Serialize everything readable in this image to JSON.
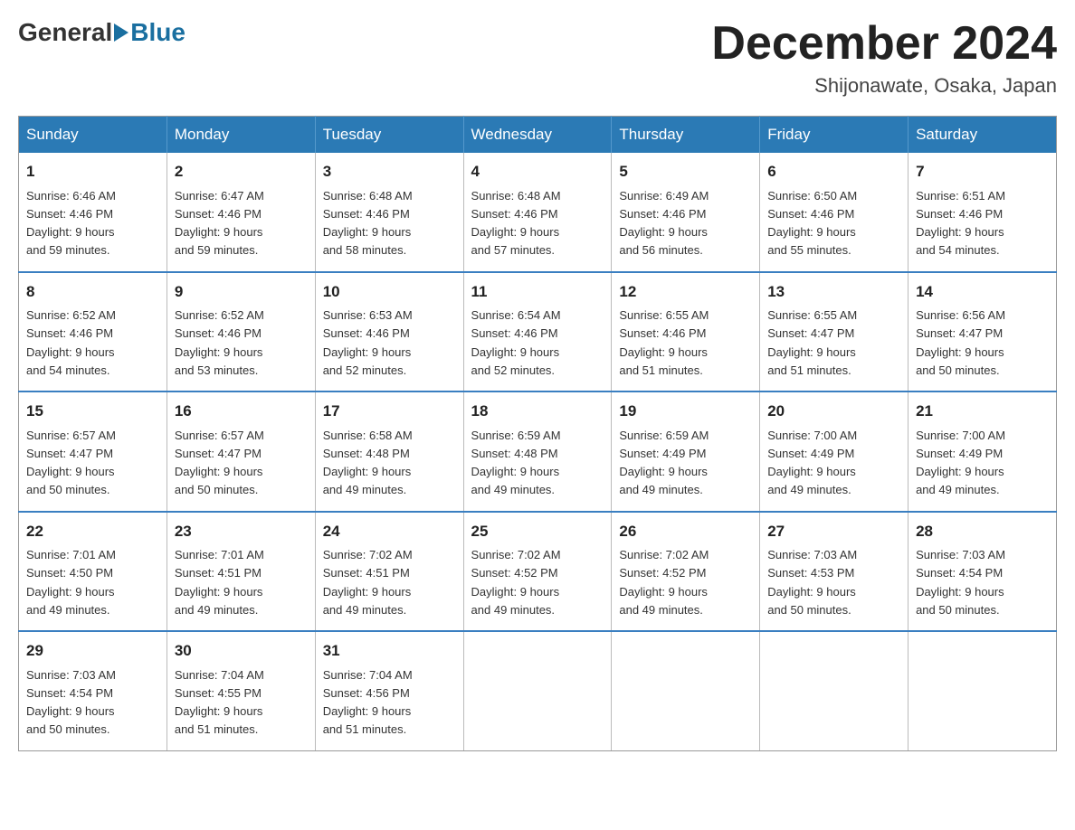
{
  "header": {
    "logo_general": "General",
    "logo_blue": "Blue",
    "month_title": "December 2024",
    "location": "Shijonawate, Osaka, Japan"
  },
  "weekdays": [
    "Sunday",
    "Monday",
    "Tuesday",
    "Wednesday",
    "Thursday",
    "Friday",
    "Saturday"
  ],
  "weeks": [
    [
      {
        "day": "1",
        "sunrise": "6:46 AM",
        "sunset": "4:46 PM",
        "daylight": "9 hours and 59 minutes."
      },
      {
        "day": "2",
        "sunrise": "6:47 AM",
        "sunset": "4:46 PM",
        "daylight": "9 hours and 59 minutes."
      },
      {
        "day": "3",
        "sunrise": "6:48 AM",
        "sunset": "4:46 PM",
        "daylight": "9 hours and 58 minutes."
      },
      {
        "day": "4",
        "sunrise": "6:48 AM",
        "sunset": "4:46 PM",
        "daylight": "9 hours and 57 minutes."
      },
      {
        "day": "5",
        "sunrise": "6:49 AM",
        "sunset": "4:46 PM",
        "daylight": "9 hours and 56 minutes."
      },
      {
        "day": "6",
        "sunrise": "6:50 AM",
        "sunset": "4:46 PM",
        "daylight": "9 hours and 55 minutes."
      },
      {
        "day": "7",
        "sunrise": "6:51 AM",
        "sunset": "4:46 PM",
        "daylight": "9 hours and 54 minutes."
      }
    ],
    [
      {
        "day": "8",
        "sunrise": "6:52 AM",
        "sunset": "4:46 PM",
        "daylight": "9 hours and 54 minutes."
      },
      {
        "day": "9",
        "sunrise": "6:52 AM",
        "sunset": "4:46 PM",
        "daylight": "9 hours and 53 minutes."
      },
      {
        "day": "10",
        "sunrise": "6:53 AM",
        "sunset": "4:46 PM",
        "daylight": "9 hours and 52 minutes."
      },
      {
        "day": "11",
        "sunrise": "6:54 AM",
        "sunset": "4:46 PM",
        "daylight": "9 hours and 52 minutes."
      },
      {
        "day": "12",
        "sunrise": "6:55 AM",
        "sunset": "4:46 PM",
        "daylight": "9 hours and 51 minutes."
      },
      {
        "day": "13",
        "sunrise": "6:55 AM",
        "sunset": "4:47 PM",
        "daylight": "9 hours and 51 minutes."
      },
      {
        "day": "14",
        "sunrise": "6:56 AM",
        "sunset": "4:47 PM",
        "daylight": "9 hours and 50 minutes."
      }
    ],
    [
      {
        "day": "15",
        "sunrise": "6:57 AM",
        "sunset": "4:47 PM",
        "daylight": "9 hours and 50 minutes."
      },
      {
        "day": "16",
        "sunrise": "6:57 AM",
        "sunset": "4:47 PM",
        "daylight": "9 hours and 50 minutes."
      },
      {
        "day": "17",
        "sunrise": "6:58 AM",
        "sunset": "4:48 PM",
        "daylight": "9 hours and 49 minutes."
      },
      {
        "day": "18",
        "sunrise": "6:59 AM",
        "sunset": "4:48 PM",
        "daylight": "9 hours and 49 minutes."
      },
      {
        "day": "19",
        "sunrise": "6:59 AM",
        "sunset": "4:49 PM",
        "daylight": "9 hours and 49 minutes."
      },
      {
        "day": "20",
        "sunrise": "7:00 AM",
        "sunset": "4:49 PM",
        "daylight": "9 hours and 49 minutes."
      },
      {
        "day": "21",
        "sunrise": "7:00 AM",
        "sunset": "4:49 PM",
        "daylight": "9 hours and 49 minutes."
      }
    ],
    [
      {
        "day": "22",
        "sunrise": "7:01 AM",
        "sunset": "4:50 PM",
        "daylight": "9 hours and 49 minutes."
      },
      {
        "day": "23",
        "sunrise": "7:01 AM",
        "sunset": "4:51 PM",
        "daylight": "9 hours and 49 minutes."
      },
      {
        "day": "24",
        "sunrise": "7:02 AM",
        "sunset": "4:51 PM",
        "daylight": "9 hours and 49 minutes."
      },
      {
        "day": "25",
        "sunrise": "7:02 AM",
        "sunset": "4:52 PM",
        "daylight": "9 hours and 49 minutes."
      },
      {
        "day": "26",
        "sunrise": "7:02 AM",
        "sunset": "4:52 PM",
        "daylight": "9 hours and 49 minutes."
      },
      {
        "day": "27",
        "sunrise": "7:03 AM",
        "sunset": "4:53 PM",
        "daylight": "9 hours and 50 minutes."
      },
      {
        "day": "28",
        "sunrise": "7:03 AM",
        "sunset": "4:54 PM",
        "daylight": "9 hours and 50 minutes."
      }
    ],
    [
      {
        "day": "29",
        "sunrise": "7:03 AM",
        "sunset": "4:54 PM",
        "daylight": "9 hours and 50 minutes."
      },
      {
        "day": "30",
        "sunrise": "7:04 AM",
        "sunset": "4:55 PM",
        "daylight": "9 hours and 51 minutes."
      },
      {
        "day": "31",
        "sunrise": "7:04 AM",
        "sunset": "4:56 PM",
        "daylight": "9 hours and 51 minutes."
      },
      null,
      null,
      null,
      null
    ]
  ],
  "labels": {
    "sunrise": "Sunrise:",
    "sunset": "Sunset:",
    "daylight": "Daylight:"
  }
}
